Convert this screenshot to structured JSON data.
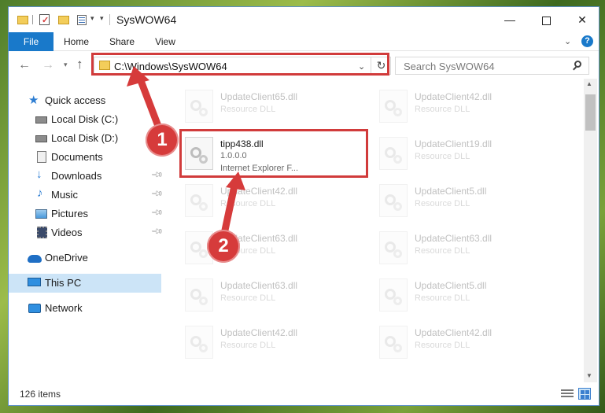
{
  "window": {
    "title": "SysWOW64"
  },
  "ribbon": {
    "tabs": [
      "File",
      "Home",
      "Share",
      "View"
    ]
  },
  "navigation": {
    "address": "C:\\Windows\\SysWOW64",
    "search_placeholder": "Search SysWOW64"
  },
  "sidebar": {
    "items": [
      {
        "label": "Quick access",
        "icon": "star-icon"
      },
      {
        "label": "Local Disk (C:)",
        "icon": "disk-icon"
      },
      {
        "label": "Local Disk (D:)",
        "icon": "disk-icon"
      },
      {
        "label": "Documents",
        "icon": "documents-icon"
      },
      {
        "label": "Downloads",
        "icon": "downloads-icon"
      },
      {
        "label": "Music",
        "icon": "music-icon"
      },
      {
        "label": "Pictures",
        "icon": "pictures-icon"
      },
      {
        "label": "Videos",
        "icon": "videos-icon"
      },
      {
        "label": "OneDrive",
        "icon": "onedrive-icon"
      },
      {
        "label": "This PC",
        "icon": "this-pc-icon"
      },
      {
        "label": "Network",
        "icon": "network-icon"
      }
    ]
  },
  "files": [
    {
      "name": "UpdateClient65.dll",
      "type": "Resource DLL"
    },
    {
      "name": "UpdateClient42.dll",
      "type": "Resource DLL"
    },
    {
      "name": "tipp438.dll",
      "version": "1.0.0.0",
      "description": "Internet Explorer F..."
    },
    {
      "name": "UpdateClient19.dll",
      "type": "Resource DLL"
    },
    {
      "name": "UpdateClient42.dll",
      "type": "Resource DLL"
    },
    {
      "name": "UpdateClient5.dll",
      "type": "Resource DLL"
    },
    {
      "name": "UpdateClient63.dll",
      "type": "Resource DLL"
    },
    {
      "name": "UpdateClient63.dll",
      "type": "Resource DLL"
    },
    {
      "name": "UpdateClient63.dll",
      "type": "Resource DLL"
    },
    {
      "name": "UpdateClient5.dll",
      "type": "Resource DLL"
    },
    {
      "name": "UpdateClient42.dll",
      "type": "Resource DLL"
    },
    {
      "name": "UpdateClient42.dll",
      "type": "Resource DLL"
    }
  ],
  "status": {
    "item_count": "126 items"
  },
  "annotations": {
    "step1": "1",
    "step2": "2",
    "color": "#d63b3b"
  }
}
